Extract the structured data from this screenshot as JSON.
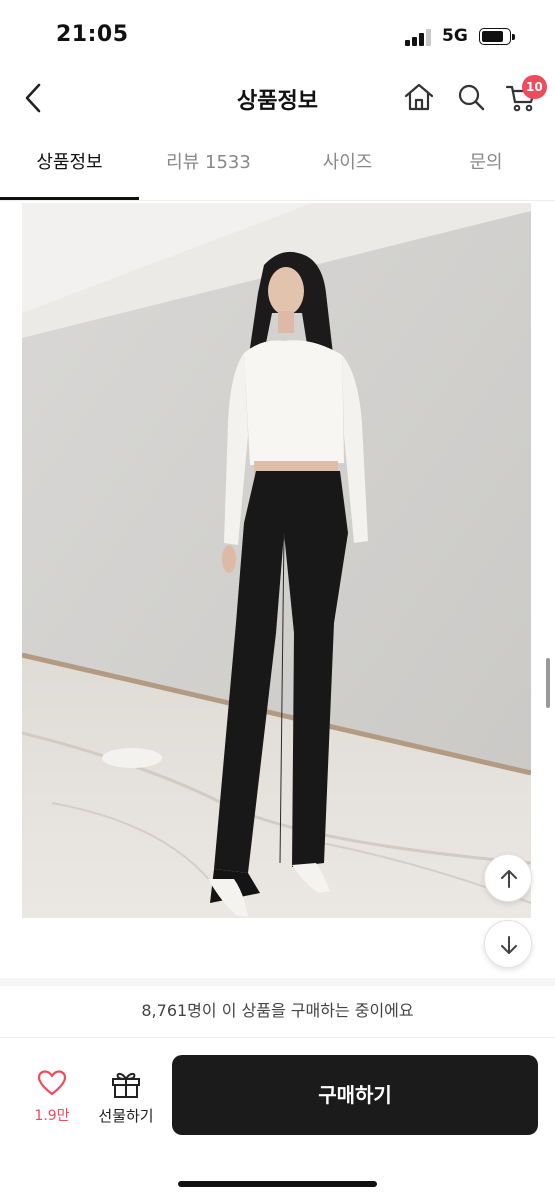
{
  "status_bar": {
    "time": "21:05",
    "network": "5G",
    "signal_bars_filled": 3,
    "signal_bars_total": 4,
    "battery_icon": "battery-icon"
  },
  "header": {
    "title": "상품정보",
    "back_icon": "chevron-left-icon",
    "home_icon": "home-icon",
    "search_icon": "search-icon",
    "cart_icon": "cart-icon",
    "cart_badge": "10"
  },
  "tabs": [
    {
      "label": "상품정보",
      "active": true
    },
    {
      "label": "리뷰 1533",
      "active": false
    },
    {
      "label": "사이즈",
      "active": false
    },
    {
      "label": "문의",
      "active": false
    }
  ],
  "product_image": {
    "scroll_top_icon": "arrow-up-icon",
    "scroll_down_icon": "arrow-down-icon"
  },
  "purchase_banner": {
    "text": "8,761명이 이 상품을 구매하는 중이에요"
  },
  "bottom_bar": {
    "like_count": "1.9만",
    "like_icon": "heart-icon",
    "gift_label": "선물하기",
    "gift_icon": "gift-icon",
    "buy_label": "구매하기"
  },
  "colors": {
    "accent": "#f04a5c",
    "buy_button": "#1b1b1b",
    "text": "#111111",
    "muted_text": "#888888"
  }
}
